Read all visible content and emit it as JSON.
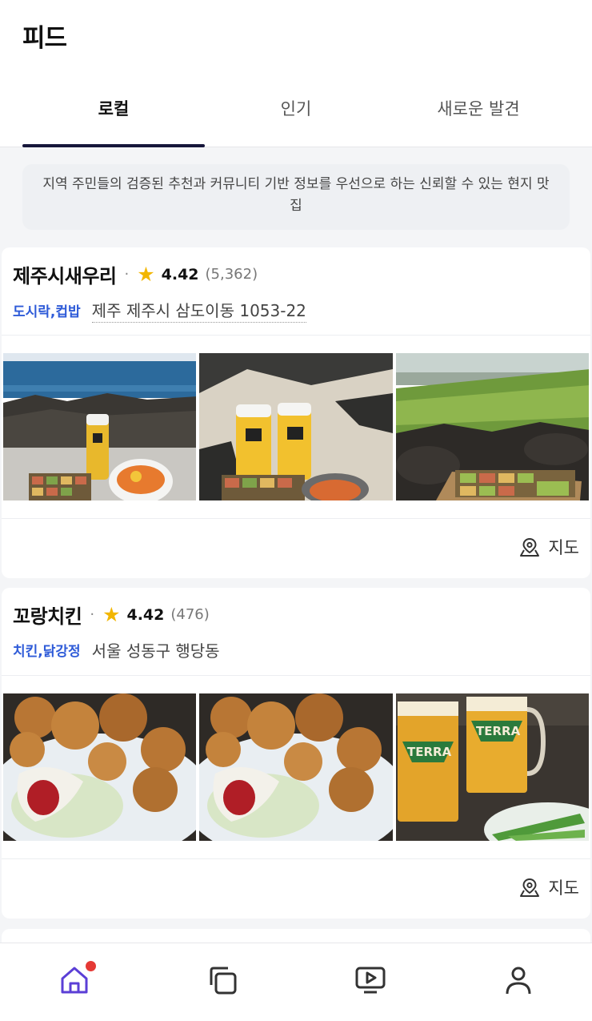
{
  "header": {
    "title": "피드",
    "tabs": [
      {
        "label": "로컬",
        "active": true
      },
      {
        "label": "인기",
        "active": false
      },
      {
        "label": "새로운 발견",
        "active": false
      }
    ]
  },
  "notice": {
    "text": "지역 주민들의 검증된 추천과 커뮤니티 기반 정보를 우선으로 하는 신뢰할 수 있는 현지 맛집"
  },
  "restaurants": [
    {
      "name": "제주시새우리",
      "rating": "4.42",
      "review_count": "(5,362)",
      "category": "도시락,컵밥",
      "address": "제주 제주시 삼도이동 1053-22",
      "map_label": "지도"
    },
    {
      "name": "꼬랑치킨",
      "rating": "4.42",
      "review_count": "(476)",
      "category": "치킨,닭강정",
      "address": "서울 성동구 행당동",
      "map_label": "지도"
    }
  ],
  "photo_text": {
    "beer_brand": "TERRA"
  },
  "bottom_nav": {
    "items": [
      "home-icon",
      "copy-icon",
      "video-icon",
      "profile-icon"
    ],
    "active": "home-icon",
    "accent": "#5b3fd6",
    "badge_color": "#e53935"
  },
  "colors": {
    "category": "#2e5bd8",
    "star": "#f2b600",
    "tab_indicator": "#16163a"
  }
}
